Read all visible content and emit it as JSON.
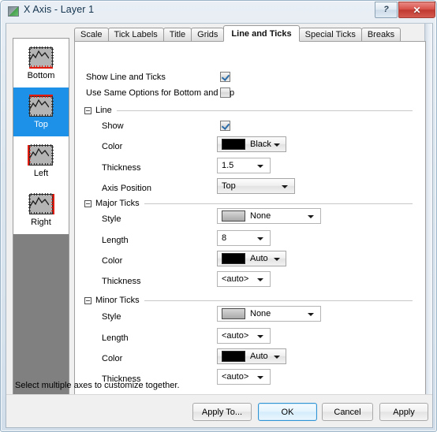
{
  "window": {
    "title": "X Axis - Layer 1",
    "icon": "app-icon",
    "help_label": "?",
    "close_label": "✕"
  },
  "tabs": [
    {
      "label": "Scale",
      "active": false
    },
    {
      "label": "Tick Labels",
      "active": false
    },
    {
      "label": "Title",
      "active": false
    },
    {
      "label": "Grids",
      "active": false
    },
    {
      "label": "Line and Ticks",
      "active": true
    },
    {
      "label": "Special Ticks",
      "active": false
    },
    {
      "label": "Breaks",
      "active": false
    }
  ],
  "sidebar": {
    "items": [
      {
        "label": "Bottom",
        "selected": false,
        "edge": "bottom"
      },
      {
        "label": "Top",
        "selected": true,
        "edge": "top"
      },
      {
        "label": "Left",
        "selected": false,
        "edge": "left"
      },
      {
        "label": "Right",
        "selected": false,
        "edge": "right"
      }
    ]
  },
  "panel": {
    "top_options": [
      {
        "label": "Show Line and Ticks",
        "checked": true
      },
      {
        "label": "Use Same Options for Bottom and Top",
        "checked": false
      }
    ],
    "groups": [
      {
        "title": "Line",
        "expanded": true,
        "rows": [
          {
            "label": "Show",
            "type": "checkbox",
            "checked": true
          },
          {
            "label": "Color",
            "type": "color-combo",
            "value": "Black",
            "swatch": "#000000",
            "style": "raised"
          },
          {
            "label": "Thickness",
            "type": "combo",
            "value": "1.5",
            "style": "flat"
          },
          {
            "label": "Axis Position",
            "type": "combo",
            "value": "Top",
            "style": "raised"
          }
        ]
      },
      {
        "title": "Major Ticks",
        "expanded": true,
        "rows": [
          {
            "label": "Style",
            "type": "style-combo",
            "value": "None",
            "swatch": "#b8b8b8",
            "style": "flat"
          },
          {
            "label": "Length",
            "type": "combo",
            "value": "8",
            "style": "flat"
          },
          {
            "label": "Color",
            "type": "color-combo",
            "value": "Auto",
            "swatch": "#000000",
            "style": "raised"
          },
          {
            "label": "Thickness",
            "type": "combo",
            "value": "<auto>",
            "style": "flat"
          }
        ]
      },
      {
        "title": "Minor Ticks",
        "expanded": true,
        "rows": [
          {
            "label": "Style",
            "type": "style-combo",
            "value": "None",
            "swatch": "#b8b8b8",
            "style": "flat"
          },
          {
            "label": "Length",
            "type": "combo",
            "value": "<auto>",
            "style": "flat"
          },
          {
            "label": "Color",
            "type": "color-combo",
            "value": "Auto",
            "swatch": "#000000",
            "style": "raised"
          },
          {
            "label": "Thickness",
            "type": "combo",
            "value": "<auto>",
            "style": "flat"
          }
        ]
      }
    ]
  },
  "statusbar": {
    "message": "Select multiple axes to customize together.",
    "buttons": [
      {
        "label": "Apply To...",
        "default": false
      },
      {
        "label": "OK",
        "default": true
      },
      {
        "label": "Cancel",
        "default": false
      },
      {
        "label": "Apply",
        "default": false
      }
    ]
  },
  "colors": {
    "selection_blue": "#1d90e8",
    "accent_red": "#e01b10",
    "list_empty_gray": "#808080"
  }
}
